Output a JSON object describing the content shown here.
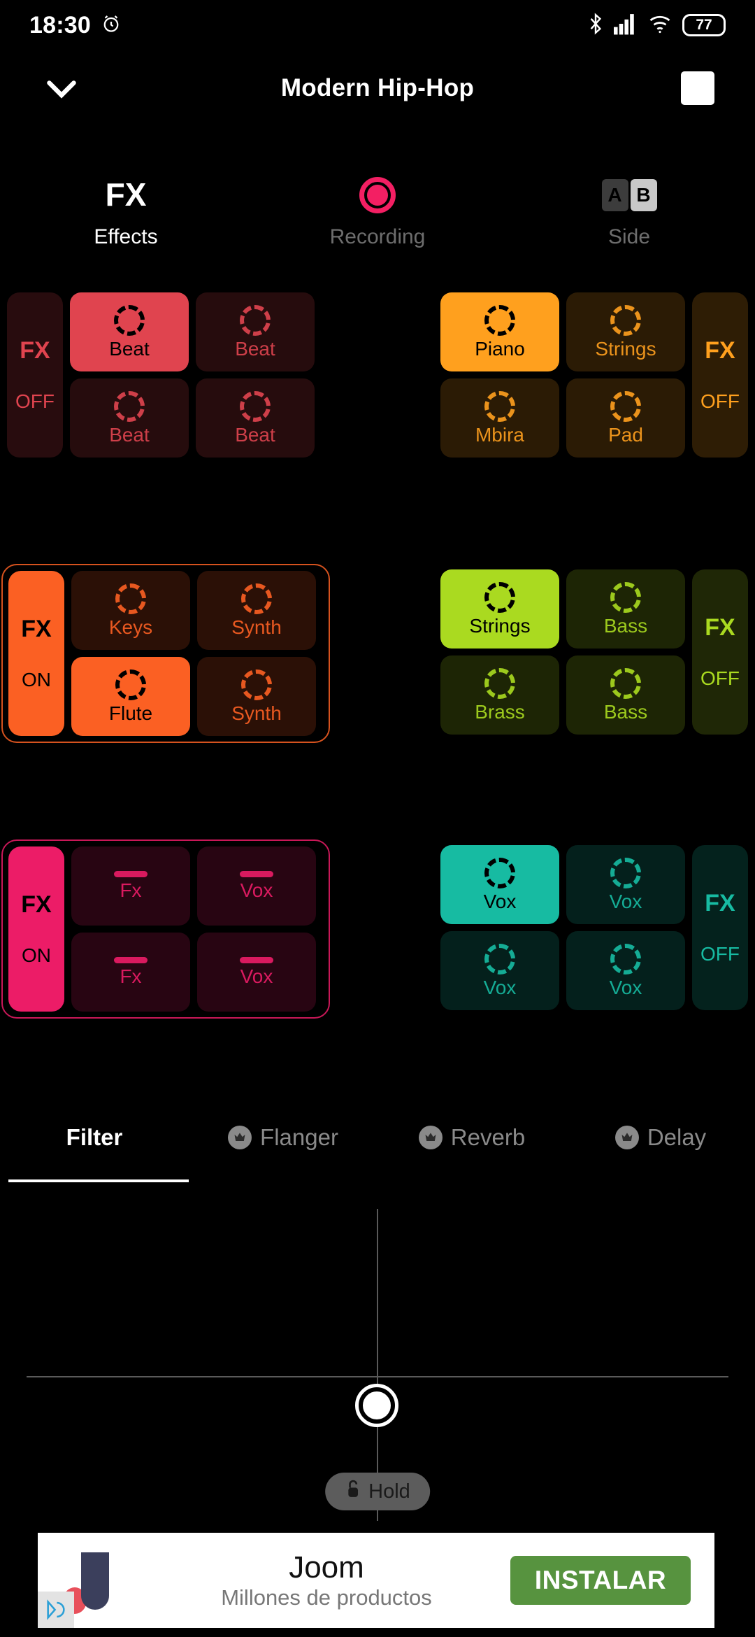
{
  "status_bar": {
    "time": "18:30",
    "alarm_icon": "alarm-clock-icon",
    "bluetooth_icon": "bluetooth-icon",
    "signal_icon": "cellular-signal-icon",
    "wifi_icon": "wifi-icon",
    "battery_level": "77"
  },
  "top_bar": {
    "collapse_icon": "chevron-down-icon",
    "title": "Modern Hip-Hop",
    "stop_button": "stop-square-icon"
  },
  "mode_row": {
    "effects": {
      "icon_text": "FX",
      "label": "Effects",
      "active": true
    },
    "recording": {
      "icon": "record-circle-icon",
      "label": "Recording",
      "active": false
    },
    "side": {
      "a": "A",
      "b": "B",
      "label": "Side",
      "active": false
    }
  },
  "banks": [
    {
      "name": "beats-bank",
      "accent": "#e0444f",
      "fx": {
        "title": "FX",
        "state": "OFF",
        "on": false
      },
      "pads": [
        {
          "label": "Beat",
          "icon": "dashed-circle-icon",
          "active": true
        },
        {
          "label": "Beat",
          "icon": "dashed-circle-icon",
          "active": false
        },
        {
          "label": "Beat",
          "icon": "dashed-circle-icon",
          "active": false
        },
        {
          "label": "Beat",
          "icon": "dashed-circle-icon",
          "active": false
        }
      ]
    },
    {
      "name": "keys-bank",
      "accent": "#ffa01e",
      "fx": {
        "title": "FX",
        "state": "OFF",
        "on": false
      },
      "pads": [
        {
          "label": "Piano",
          "icon": "dashed-circle-icon",
          "active": true
        },
        {
          "label": "Strings",
          "icon": "dashed-circle-icon",
          "active": false
        },
        {
          "label": "Mbira",
          "icon": "dashed-circle-icon",
          "active": false
        },
        {
          "label": "Pad",
          "icon": "dashed-circle-icon",
          "active": false
        }
      ]
    },
    {
      "name": "synth-bank",
      "accent": "#fb6023",
      "fx": {
        "title": "FX",
        "state": "ON",
        "on": true
      },
      "pads": [
        {
          "label": "Keys",
          "icon": "dashed-circle-icon",
          "active": false
        },
        {
          "label": "Synth",
          "icon": "dashed-circle-icon",
          "active": false
        },
        {
          "label": "Flute",
          "icon": "dashed-circle-icon",
          "active": true
        },
        {
          "label": "Synth",
          "icon": "dashed-circle-icon",
          "active": false
        }
      ]
    },
    {
      "name": "bass-bank",
      "accent": "#aada20",
      "fx": {
        "title": "FX",
        "state": "OFF",
        "on": false
      },
      "pads": [
        {
          "label": "Strings",
          "icon": "dashed-circle-icon",
          "active": true
        },
        {
          "label": "Bass",
          "icon": "dashed-circle-icon",
          "active": false
        },
        {
          "label": "Brass",
          "icon": "dashed-circle-icon",
          "active": false
        },
        {
          "label": "Bass",
          "icon": "dashed-circle-icon",
          "active": false
        }
      ]
    },
    {
      "name": "fxvox-bank",
      "accent": "#ec1c67",
      "fx": {
        "title": "FX",
        "state": "ON",
        "on": true
      },
      "pads": [
        {
          "label": "Fx",
          "icon": "dash-bar-icon",
          "active": false
        },
        {
          "label": "Vox",
          "icon": "dash-bar-icon",
          "active": false
        },
        {
          "label": "Fx",
          "icon": "dash-bar-icon",
          "active": false
        },
        {
          "label": "Vox",
          "icon": "dash-bar-icon",
          "active": false
        }
      ]
    },
    {
      "name": "vox-bank",
      "accent": "#17bba2",
      "fx": {
        "title": "FX",
        "state": "OFF",
        "on": false
      },
      "pads": [
        {
          "label": "Vox",
          "icon": "dashed-circle-icon",
          "active": true
        },
        {
          "label": "Vox",
          "icon": "dashed-circle-icon",
          "active": false
        },
        {
          "label": "Vox",
          "icon": "dashed-circle-icon",
          "active": false
        },
        {
          "label": "Vox",
          "icon": "dashed-circle-icon",
          "active": false
        }
      ]
    }
  ],
  "effect_tabs": [
    {
      "label": "Filter",
      "locked": false,
      "active": true
    },
    {
      "label": "Flanger",
      "locked": true,
      "active": false
    },
    {
      "label": "Reverb",
      "locked": true,
      "active": false
    },
    {
      "label": "Delay",
      "locked": true,
      "active": false
    }
  ],
  "xy_pad": {
    "knob_icon": "xy-knob-icon",
    "hold": {
      "label": "Hold",
      "icon": "lock-icon"
    }
  },
  "ad": {
    "title": "Joom",
    "subtitle": "Millones de productos",
    "cta": "INSTALAR",
    "logo_icon": "joom-logo-icon",
    "adchoices_icon": "adchoices-icon"
  }
}
